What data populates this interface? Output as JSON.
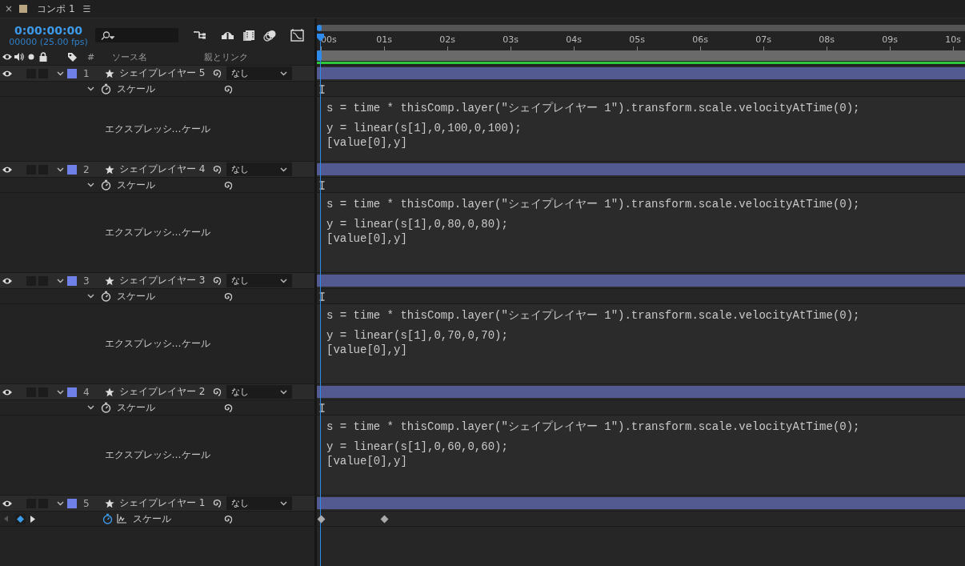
{
  "panel": {
    "close": "×",
    "title": "コンポ 1",
    "menu": "☰",
    "color": "#b9a582"
  },
  "timecode": "0:00:00:00",
  "frames": "00000 (25.00 fps)",
  "columns": [
    "#",
    "ソース名",
    "親とリンク"
  ],
  "ruler": [
    "00s",
    "01s",
    "02s",
    "03s",
    "04s",
    "05s",
    "06s",
    "07s",
    "08s",
    "09s",
    "10s"
  ],
  "layers": [
    {
      "number": "1",
      "name": "シェイプレイヤー 5",
      "parent": "なし",
      "color": "#6f80e8",
      "visible": true,
      "solo": false,
      "locked": false,
      "expanded": true,
      "property": {
        "kind": "expression",
        "name": "スケール",
        "label": "エクスプレッシ…ケール",
        "lines": [
          "s = time * thisComp.layer(\"シェイプレイヤー 1\").transform.scale.velocityAtTime(0);",
          "y = linear(s[1],0,100,0,100);",
          "[value[0],y]"
        ]
      }
    },
    {
      "number": "2",
      "name": "シェイプレイヤー 4",
      "parent": "なし",
      "color": "#6f80e8",
      "visible": true,
      "solo": false,
      "locked": false,
      "expanded": true,
      "property": {
        "kind": "expression",
        "name": "スケール",
        "label": "エクスプレッシ…ケール",
        "lines": [
          "s = time * thisComp.layer(\"シェイプレイヤー 1\").transform.scale.velocityAtTime(0);",
          "y = linear(s[1],0,80,0,80);",
          "[value[0],y]"
        ]
      }
    },
    {
      "number": "3",
      "name": "シェイプレイヤー 3",
      "parent": "なし",
      "color": "#6f80e8",
      "visible": true,
      "solo": false,
      "locked": false,
      "expanded": true,
      "property": {
        "kind": "expression",
        "name": "スケール",
        "label": "エクスプレッシ…ケール",
        "lines": [
          "s = time * thisComp.layer(\"シェイプレイヤー 1\").transform.scale.velocityAtTime(0);",
          "y = linear(s[1],0,70,0,70);",
          "[value[0],y]"
        ]
      }
    },
    {
      "number": "4",
      "name": "シェイプレイヤー 2",
      "parent": "なし",
      "color": "#6f80e8",
      "visible": true,
      "solo": false,
      "locked": false,
      "expanded": true,
      "property": {
        "kind": "expression",
        "name": "スケール",
        "label": "エクスプレッシ…ケール",
        "lines": [
          "s = time * thisComp.layer(\"シェイプレイヤー 1\").transform.scale.velocityAtTime(0);",
          "y = linear(s[1],0,60,0,60);",
          "[value[0],y]"
        ]
      }
    },
    {
      "number": "5",
      "name": "シェイプレイヤー 1",
      "parent": "なし",
      "color": "#6f80e8",
      "visible": true,
      "solo": false,
      "locked": false,
      "expanded": true,
      "property": {
        "kind": "keyframes",
        "name": "スケール",
        "keyframes": [
          {
            "selected": false
          },
          {
            "selected": false
          }
        ]
      }
    }
  ]
}
